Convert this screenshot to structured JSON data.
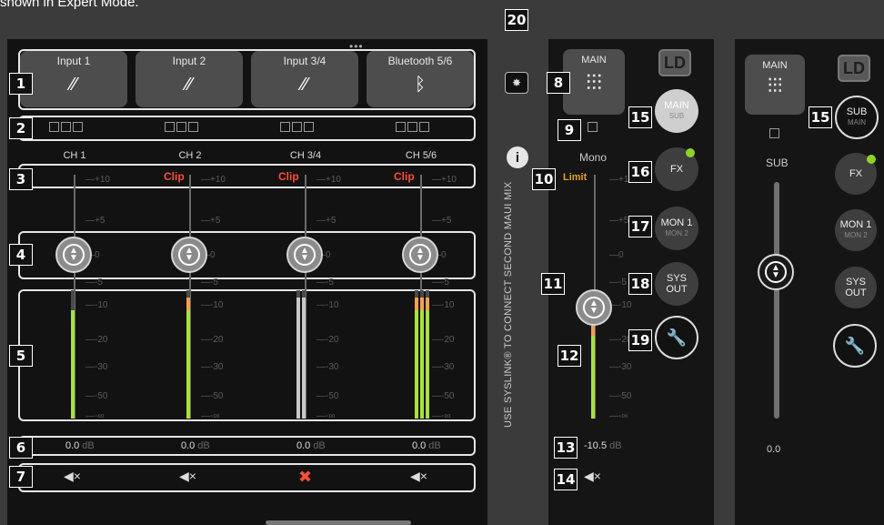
{
  "caption": "shown in Expert Mode.",
  "badges": [
    "1",
    "2",
    "3",
    "4",
    "5",
    "6",
    "7",
    "8",
    "9",
    "10",
    "11",
    "12",
    "13",
    "14",
    "15",
    "16",
    "17",
    "18",
    "19",
    "20",
    "15"
  ],
  "inputs": [
    {
      "label": "Input 1",
      "icon": "jack-cable-icon",
      "glyph": "⚡"
    },
    {
      "label": "Input 2",
      "icon": "jack-cable-icon",
      "glyph": "⚡"
    },
    {
      "label": "Input 3/4",
      "icon": "jack-cable-icon",
      "glyph": "⚡"
    },
    {
      "label": "Bluetooth 5/6",
      "icon": "bluetooth-icon",
      "glyph": "ᛒ"
    }
  ],
  "channels": [
    {
      "label": "CH 1",
      "clip": "",
      "level": "0.0",
      "unit": "dB",
      "muted": false
    },
    {
      "label": "CH 2",
      "clip": "Clip",
      "level": "0.0",
      "unit": "dB",
      "muted": false
    },
    {
      "label": "CH 3/4",
      "clip": "Clip",
      "level": "0.0",
      "unit": "dB",
      "muted": true
    },
    {
      "label": "CH 5/6",
      "clip": "Clip",
      "level": "0.0",
      "unit": "dB",
      "muted": false
    }
  ],
  "scale": [
    "+10",
    "+5",
    "0",
    "-5",
    "-10",
    "-20",
    "-30",
    "-50",
    "-∞"
  ],
  "main": {
    "button_label": "MAIN",
    "mode": "Mono",
    "limit": "Limit",
    "level": "-10.5",
    "unit": "dB",
    "syslink_text": "USE SYSLINK® TO CONNECT SECOND MAUI MIX",
    "logo": "LD",
    "info": "i",
    "buttons": [
      {
        "label": "MAIN",
        "sub": "SUB"
      },
      {
        "label": "FX",
        "sub": ""
      },
      {
        "label": "MON 1",
        "sub": "MON 2"
      },
      {
        "label": "SYS",
        "sub": "OUT"
      }
    ]
  },
  "sub": {
    "button_label": "MAIN",
    "fader_label": "SUB",
    "level": "0.0",
    "logo": "LD",
    "buttons": [
      {
        "label": "SUB",
        "sub": "MAIN"
      },
      {
        "label": "FX",
        "sub": ""
      },
      {
        "label": "MON 1",
        "sub": "MON 2"
      },
      {
        "label": "SYS",
        "sub": "OUT"
      }
    ]
  },
  "colors": {
    "accent": "#8ed32b",
    "clip": "#ff4d3a",
    "limit": "#e0a030",
    "meter_green": "#a9e23a",
    "meter_orange": "#f2a055",
    "meter_red": "#e0443a"
  }
}
